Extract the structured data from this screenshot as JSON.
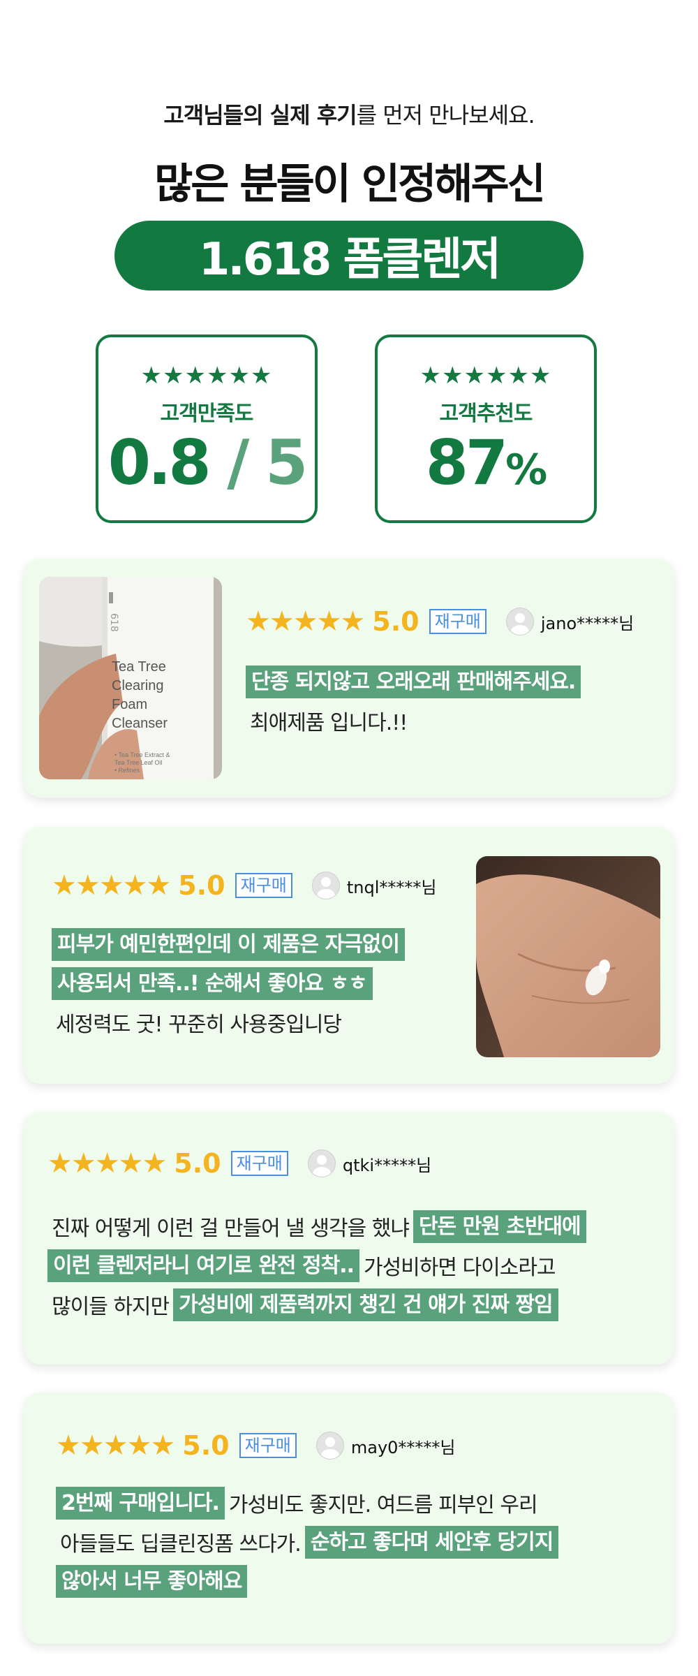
{
  "intro": {
    "part1": "고객님들의 실제 후기",
    "part2": "를 먼저 만나보세요."
  },
  "headline": "많은 분들이 인정해주신",
  "product_pill": "1.618 폼클렌저",
  "stats": [
    {
      "stars": "★★★★★★",
      "label": "고객만족도",
      "value_main": "0.8",
      "value_rest": " / 5"
    },
    {
      "stars": "★★★★★★",
      "label": "고객추천도",
      "value_main": "87",
      "value_rest": "%"
    }
  ],
  "photos": {
    "product_text": [
      "Tea Tree",
      "Clearing",
      "Foam",
      "Cleanser"
    ],
    "brand_mark": "618",
    "small_text": [
      "• Tea Tree Extract &",
      "  Tea Tree Leaf Oil",
      "• Refines"
    ]
  },
  "reviews": [
    {
      "stars": "★★★★★",
      "rating": "5.0",
      "badge": "재구매",
      "user": "jano*****님",
      "line1_hl": "단종 되지않고 오래오래 판매해주세요.",
      "line2": "최애제품 입니다.!!"
    },
    {
      "stars": "★★★★★",
      "rating": "5.0",
      "badge": "재구매",
      "user": "tnql*****님",
      "line1_hl": "피부가 예민한편인데 이 제품은 자극없이",
      "line2_hl": "사용되서 만족..! 순해서 좋아요 ㅎㅎ",
      "line3": "세정력도 굿! 꾸준히 사용중입니당"
    },
    {
      "stars": "★★★★★",
      "rating": "5.0",
      "badge": "재구매",
      "user": "qtki*****님",
      "line1": "진짜 어떻게 이런 걸 만들어 낼 생각을 했냐",
      "line1_hl": "단돈 만원 초반대에",
      "line2_hl": "이런 클렌저라니 여기로 완전 정착..",
      "line2": "가성비하면 다이소라고",
      "line3": "많이들 하지만",
      "line3_hl": "가성비에 제품력까지 챙긴 건  얘가 진짜 짱임"
    },
    {
      "stars": "★★★★★",
      "rating": "5.0",
      "badge": "재구매",
      "user": "may0*****님",
      "line1_hl": "2번째  구매입니다.",
      "line1": "가성비도 좋지만.  여드름 피부인 우리",
      "line2": "아들들도 딥클린징폼  쓰다가.",
      "line2_hl": "순하고 좋다며 세안후 당기지",
      "line3_hl": "않아서 너무 좋아해요"
    }
  ],
  "colors": {
    "brand_green": "#127a41",
    "light_green": "#5aa27c",
    "card_bg": "#eefbed",
    "star_gold": "#f4b41f",
    "badge_blue": "#4a8ee0"
  }
}
